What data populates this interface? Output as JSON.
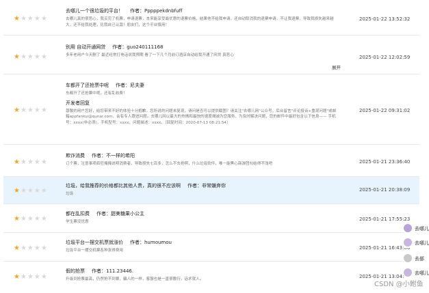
{
  "rows": [
    {
      "title": "去哪儿一个很垃圾的平台！",
      "author": "作者：Pppppekdnbfuff",
      "body": "去哪儿真的很恶心，我买完了机票，申请退票，本来能享受最优惠的退票价格，结果他不给我申请，还自动取消我的退票申请，不让我退票，导致我损失越来越大，还不给我处理，比我自己认栽！朋友们，这个平台慎用！",
      "time": "2025-01-22 13:52:32",
      "rating": 1
    },
    {
      "title": "别用 自动开通网贷",
      "author": "作者：guo240111168",
      "body": "多年老用户今天删了 最近经常打电话说我预期 看了一下几个月前订酒店自动给我开通了网贷 真恶心",
      "expand": "展开",
      "time": "2025-01-22 12:02:59",
      "rating": 1
    },
    {
      "title": "车都开了还抢票中呢",
      "author": "作者：尼夫妻",
      "body": "车都开了还抢票中呢，还有乱收费！",
      "reply_heading": "开发者回复",
      "reply": "尊敬的用户您好，给您带来不好的体验十分抱歉。您所说的问题未复现，请问是否可以提供截图？请关注\"去哪儿网\"公众号，后台留言\"评论投诉+重现问题\"或邮箱appfankui@qunar.com，会有专人跟进问题。去哪儿网以最大的热情和最快的速度竭诚为您服务，为及时解决问题，您的邮件中最好包含以下信息—— 手机号：xxxx(非必须)，手机型号：xxxx，问题描述：xxxx。（回复时间：2020-07-13 08:21:54）",
      "time": "2025-01-22 09:31:02",
      "rating": 1
    },
    {
      "title": "欺诈消费",
      "author": "作者：不一样的希阳",
      "body": "订个票，注意事项疯狂掩掩说明消费者，导致损失七百多，怎么不去抢啊，什么垃圾软件，唯一能黑心商游团勾结得不浅吧",
      "time": "2025-01-21 23:36:40",
      "rating": 1
    },
    {
      "title": "垃圾，给我推荐的价格都比其他人贵，真的很不应该啊",
      "author": "作者：非常嫌弃你",
      "body": "垃圾",
      "time": "2025-01-21 20:38:09",
      "rating": 1
    },
    {
      "title": "都在乱扣费",
      "author": "作者：甜美糖果小公主",
      "body": "学生票没优惠",
      "time": "2025-01-21 17:55:23",
      "rating": 1
    },
    {
      "title": "垃圾平台一摆交机票就涨价",
      "author": "作者：humoumou",
      "body": "垃圾平台一摆交机票各种涨得费用",
      "time": "2025-01-21 16:43:06",
      "rating": 1
    },
    {
      "title": "假的抢票",
      "author": "作者：111.23446.",
      "body": "升级到抢票最高，仍然抢不到票，骗人的一样，客服也是一直很敷衍，话术就人。",
      "time": "2025-01-21 13:04:16",
      "rating": 1
    }
  ],
  "side_items": [
    "去哪儿",
    "去哪儿",
    "去部",
    "去哪儿"
  ],
  "watermark": "CSDN @小鲋鱼"
}
